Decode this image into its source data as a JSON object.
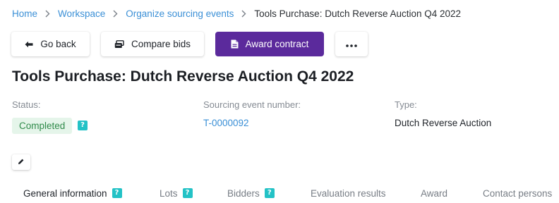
{
  "breadcrumb": {
    "items": [
      "Home",
      "Workspace",
      "Organize sourcing events"
    ],
    "current": "Tools Purchase: Dutch Reverse Auction Q4 2022"
  },
  "toolbar": {
    "back_label": "Go back",
    "compare_label": "Compare bids",
    "award_label": "Award contract",
    "more_label": "•••"
  },
  "page": {
    "title": "Tools Purchase: Dutch Reverse Auction Q4 2022"
  },
  "details": {
    "status_label": "Status:",
    "status_value": "Completed",
    "event_number_label": "Sourcing event number:",
    "event_number_value": "T-0000092",
    "type_label": "Type:",
    "type_value": "Dutch Reverse Auction"
  },
  "help_glyph": "?",
  "tabs": [
    {
      "label": "General information",
      "active": true
    },
    {
      "label": "Lots"
    },
    {
      "label": "Bidders"
    },
    {
      "label": "Evaluation results"
    },
    {
      "label": "Award"
    },
    {
      "label": "Contact persons"
    }
  ],
  "colors": {
    "accent": "#5b2a9c",
    "link": "#3a8fd6",
    "status_bg": "#e5f5ea",
    "status_text": "#2e8a49",
    "help_bg": "#23c2c6"
  },
  "icons": {
    "separator": "chevron-right-icon",
    "back": "arrow-left-icon",
    "compare": "compare-bids-icon",
    "award": "document-icon",
    "more": "ellipsis-icon",
    "edit": "pencil-icon",
    "help": "question-icon"
  }
}
